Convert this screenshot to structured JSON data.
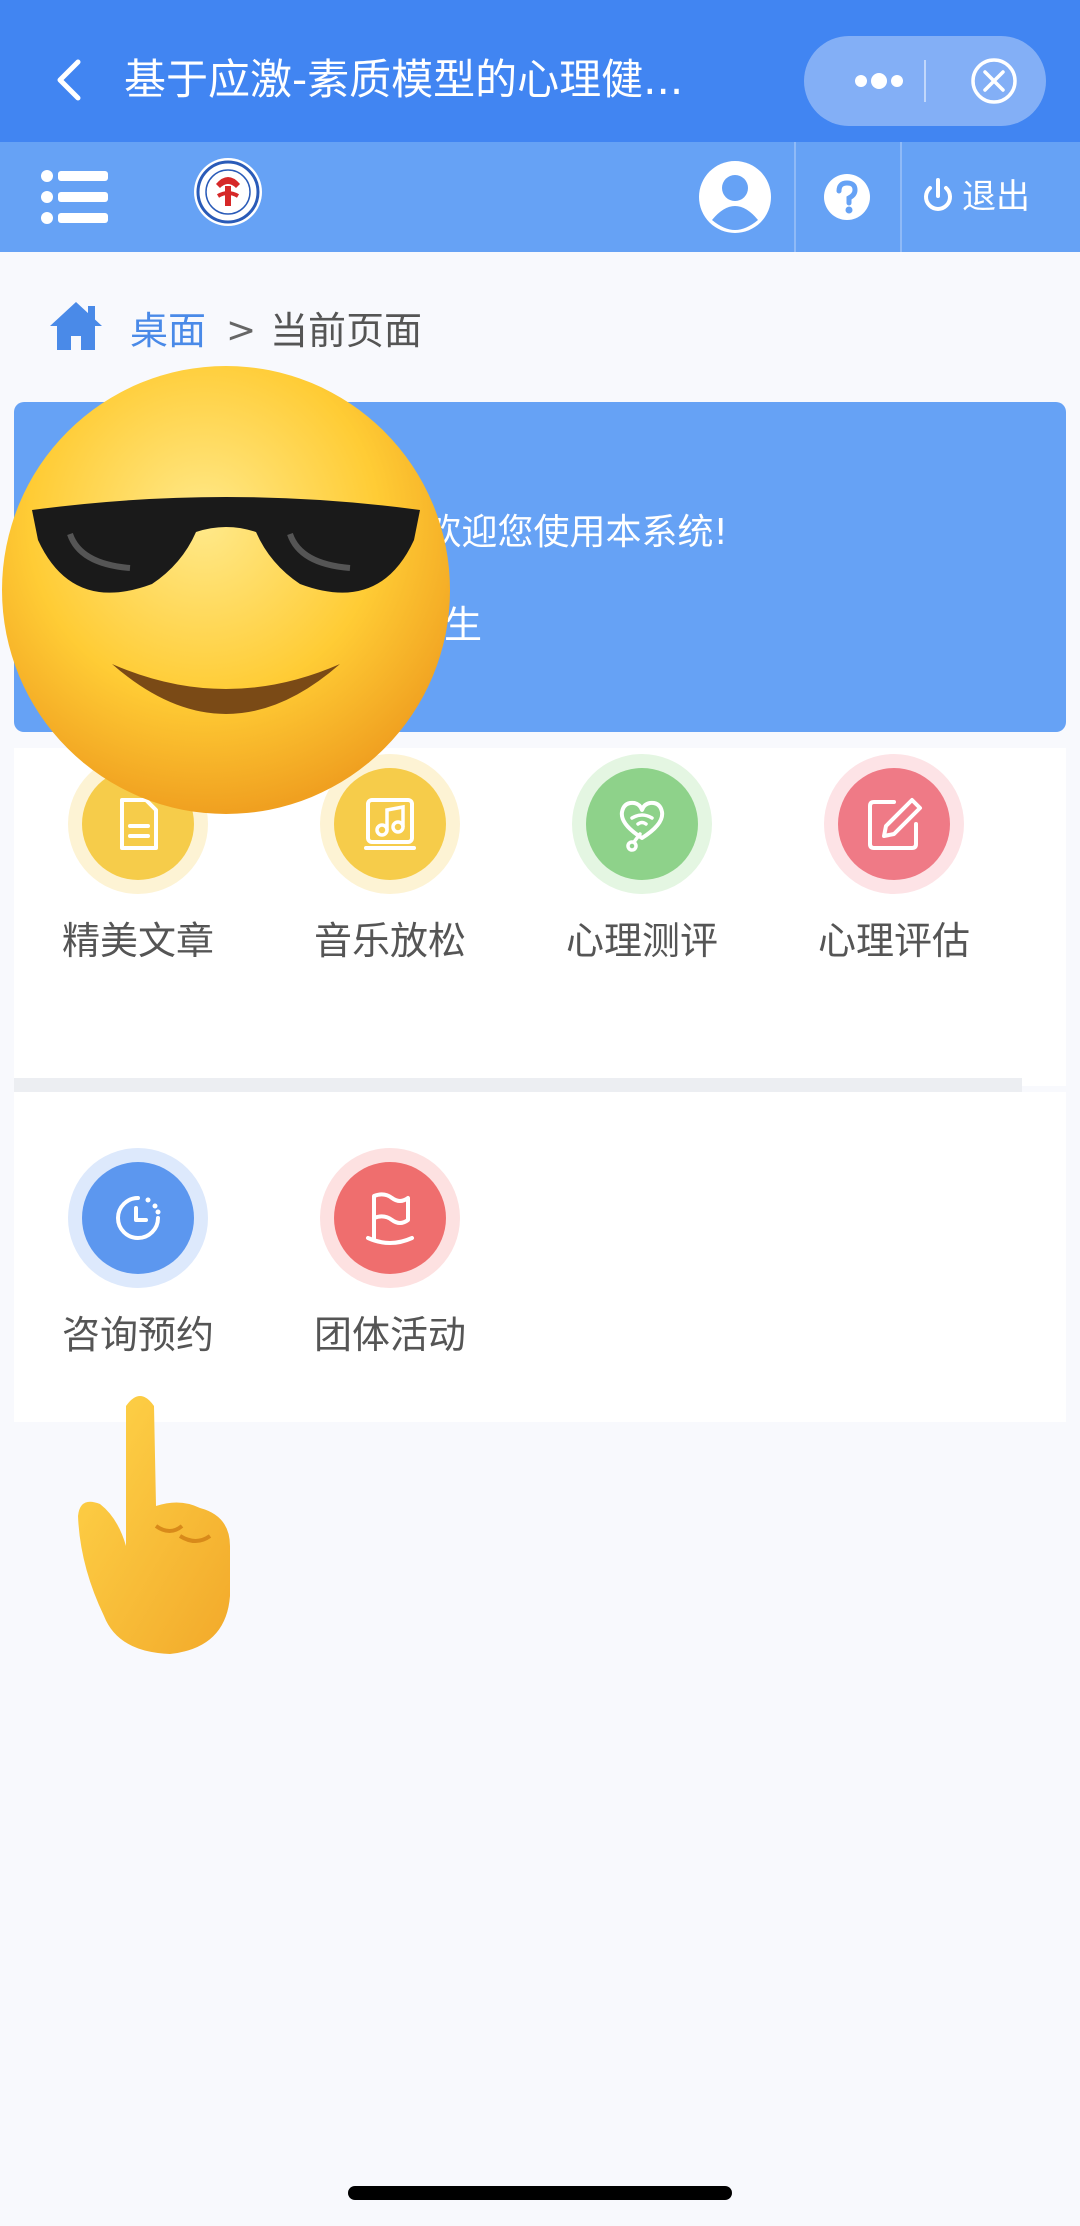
{
  "titlebar": {
    "title": "基于应激-素质模型的心理健...",
    "back_icon": "chevron-left-icon",
    "more_icon": "more-dots-icon",
    "close_icon": "circle-close-icon"
  },
  "navbar": {
    "menu_icon": "list-menu-icon",
    "logo_icon": "school-logo-icon",
    "avatar_icon": "user-avatar-icon",
    "help_icon": "help-question-icon",
    "logout_label": "退出"
  },
  "breadcrumb": {
    "home_label": "桌面",
    "separator": ">",
    "current_label": "当前页面"
  },
  "welcome": {
    "line1": ",欢迎您使用本系统!",
    "line2": "生"
  },
  "grid1": [
    {
      "label": "精美文章",
      "icon": "document-icon",
      "color": "#f6cc4a",
      "ring": "#fdf3d4"
    },
    {
      "label": "音乐放松",
      "icon": "music-icon",
      "color": "#f6cc4a",
      "ring": "#fdf3d4"
    },
    {
      "label": "心理测评",
      "icon": "heart-stethoscope-icon",
      "color": "#8ed28a",
      "ring": "#e4f6e2"
    },
    {
      "label": "心理评估",
      "icon": "edit-icon",
      "color": "#ef7a86",
      "ring": "#fde3e6"
    }
  ],
  "grid2": [
    {
      "label": "咨询预约",
      "icon": "clock-icon",
      "color": "#5c97ef",
      "ring": "#dde9fc"
    },
    {
      "label": "团体活动",
      "icon": "flag-icon",
      "color": "#ef6e6e",
      "ring": "#fde1e1"
    }
  ],
  "overlays": {
    "sunglasses_emoji": "smiling-face-with-sunglasses-icon",
    "pointing_emoji": "pointing-up-hand-icon"
  },
  "colors": {
    "titlebar": "#4185f2",
    "navbar": "#66a2f5",
    "accent": "#4a8ae8"
  }
}
